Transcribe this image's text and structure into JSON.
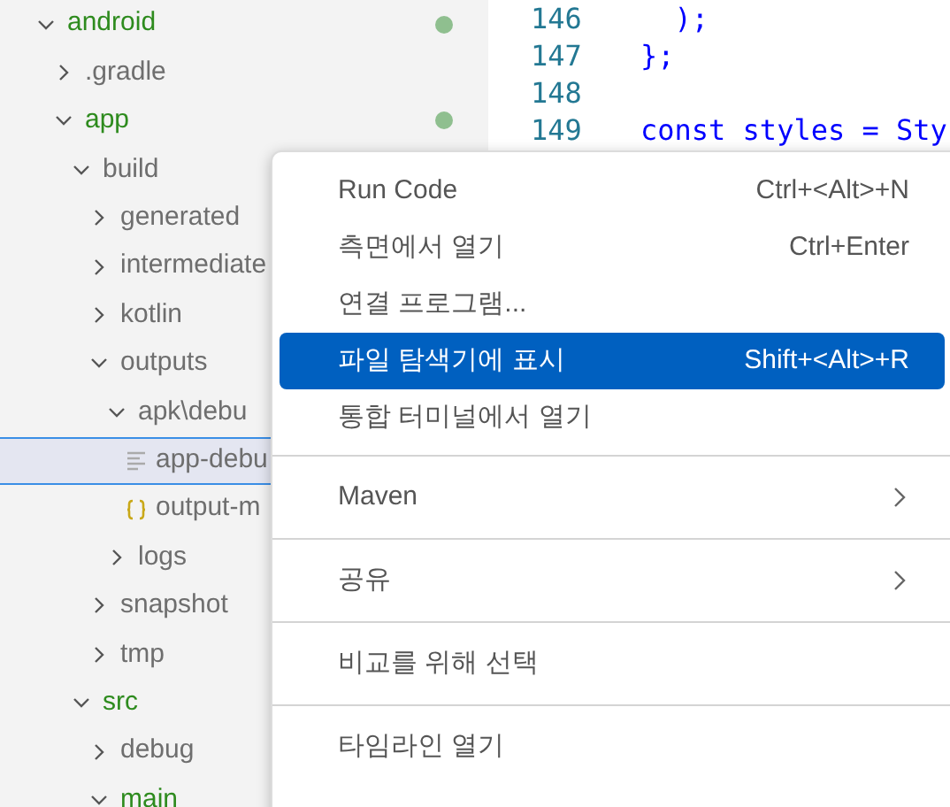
{
  "tree": [
    {
      "name": "android",
      "kind": "folder",
      "expanded": true,
      "color": "#2e8b1e",
      "modified": true,
      "selected": false,
      "children": [
        {
          "name": ".gradle",
          "kind": "folder",
          "expanded": false,
          "color": "#6e6e6e",
          "modified": false,
          "selected": false
        },
        {
          "name": "app",
          "kind": "folder",
          "expanded": true,
          "color": "#2e8b1e",
          "modified": true,
          "selected": false,
          "children": [
            {
              "name": "build",
              "kind": "folder",
              "expanded": true,
              "color": "#6e6e6e",
              "modified": false,
              "selected": false,
              "children": [
                {
                  "name": "generated",
                  "kind": "folder",
                  "expanded": false,
                  "color": "#6e6e6e",
                  "modified": false,
                  "selected": false
                },
                {
                  "name": "intermediate",
                  "kind": "folder",
                  "expanded": false,
                  "color": "#6e6e6e",
                  "modified": false,
                  "selected": false
                },
                {
                  "name": "kotlin",
                  "kind": "folder",
                  "expanded": false,
                  "color": "#6e6e6e",
                  "modified": false,
                  "selected": false
                },
                {
                  "name": "outputs",
                  "kind": "folder",
                  "expanded": true,
                  "color": "#6e6e6e",
                  "modified": false,
                  "selected": false,
                  "children": [
                    {
                      "name": "apk\\debu",
                      "kind": "folder",
                      "expanded": true,
                      "color": "#6e6e6e",
                      "modified": false,
                      "selected": false,
                      "children": [
                        {
                          "name": "app-debu",
                          "kind": "file",
                          "color": "#6e6e6e",
                          "modified": false,
                          "selected": true
                        },
                        {
                          "name": "output-m",
                          "kind": "json",
                          "color": "#6e6e6e",
                          "modified": false,
                          "selected": false
                        }
                      ]
                    },
                    {
                      "name": "logs",
                      "kind": "folder",
                      "expanded": false,
                      "color": "#6e6e6e",
                      "modified": false,
                      "selected": false
                    }
                  ]
                },
                {
                  "name": "snapshot",
                  "kind": "folder",
                  "expanded": false,
                  "color": "#6e6e6e",
                  "modified": false,
                  "selected": false
                },
                {
                  "name": "tmp",
                  "kind": "folder",
                  "expanded": false,
                  "color": "#6e6e6e",
                  "modified": false,
                  "selected": false
                }
              ]
            },
            {
              "name": "src",
              "kind": "folder",
              "expanded": true,
              "color": "#2e8b1e",
              "modified": false,
              "selected": false,
              "children": [
                {
                  "name": "debug",
                  "kind": "folder",
                  "expanded": false,
                  "color": "#6e6e6e",
                  "modified": false,
                  "selected": false
                },
                {
                  "name": "main",
                  "kind": "folder",
                  "expanded": true,
                  "color": "#2e8b1e",
                  "modified": false,
                  "selected": false
                }
              ]
            }
          ]
        }
      ]
    }
  ],
  "editor": {
    "lines": [
      {
        "number": "146",
        "code": "  );"
      },
      {
        "number": "147",
        "code": "};"
      },
      {
        "number": "148"
      },
      {
        "number": "149",
        "code": "const styles = Sty"
      }
    ]
  },
  "context_menu": {
    "groups": [
      [
        {
          "label": "Run Code",
          "shortcut": "Ctrl+<Alt>+N",
          "selected": false,
          "submenu": false
        },
        {
          "label": "측면에서 열기",
          "shortcut": "Ctrl+Enter",
          "selected": false,
          "submenu": false
        },
        {
          "label": "연결 프로그램...",
          "selected": false,
          "submenu": false
        },
        {
          "label": "파일 탐색기에 표시",
          "shortcut": "Shift+<Alt>+R",
          "selected": true,
          "submenu": false
        },
        {
          "label": "통합 터미널에서 열기",
          "selected": false,
          "submenu": false
        }
      ],
      [
        {
          "label": "Maven",
          "selected": false,
          "submenu": true
        }
      ],
      [
        {
          "label": "공유",
          "selected": false,
          "submenu": true
        }
      ],
      [
        {
          "label": "비교를 위해 선택",
          "selected": false,
          "submenu": false
        }
      ],
      [
        {
          "label": "타임라인 열기",
          "selected": false,
          "submenu": false
        }
      ]
    ]
  }
}
